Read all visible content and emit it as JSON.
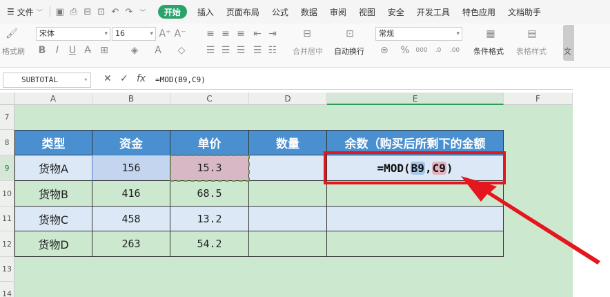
{
  "menubar": {
    "file_label": "文件",
    "tabs": [
      "开始",
      "插入",
      "页面布局",
      "公式",
      "数据",
      "审阅",
      "视图",
      "安全",
      "开发工具",
      "特色应用",
      "文档助手"
    ],
    "active_tab": "开始"
  },
  "ribbon": {
    "format_painter": "格式刷",
    "font_name": "宋体",
    "font_size": "16",
    "merge_center": "合并居中",
    "wrap_text": "自动换行",
    "number_format": "常规",
    "conditional_format": "条件格式",
    "table_style": "表格样式",
    "right_label": "文"
  },
  "formula_bar": {
    "name_box": "SUBTOTAL",
    "formula": "=MOD(B9,C9)"
  },
  "columns": [
    "A",
    "B",
    "C",
    "D",
    "E",
    "F"
  ],
  "rows": [
    "7",
    "8",
    "9",
    "10",
    "11",
    "12",
    "13",
    "14"
  ],
  "table": {
    "headers": [
      "类型",
      "资金",
      "单价",
      "数量",
      "余数（购买后所剩下的金额"
    ],
    "rows": [
      {
        "type": "货物A",
        "fund": "156",
        "price": "15.3",
        "qty": ""
      },
      {
        "type": "货物B",
        "fund": "416",
        "price": "68.5",
        "qty": ""
      },
      {
        "type": "货物C",
        "fund": "458",
        "price": "13.2",
        "qty": ""
      },
      {
        "type": "货物D",
        "fund": "263",
        "price": "54.2",
        "qty": ""
      }
    ],
    "editing": {
      "prefix": "=MOD(",
      "ref1": "B9",
      "comma": ",",
      "ref2": "C9",
      "suffix": ")"
    }
  },
  "colors": {
    "accent": "#2aa36b",
    "header_blue": "#4a8fd0",
    "callout_red": "#e5161d"
  }
}
